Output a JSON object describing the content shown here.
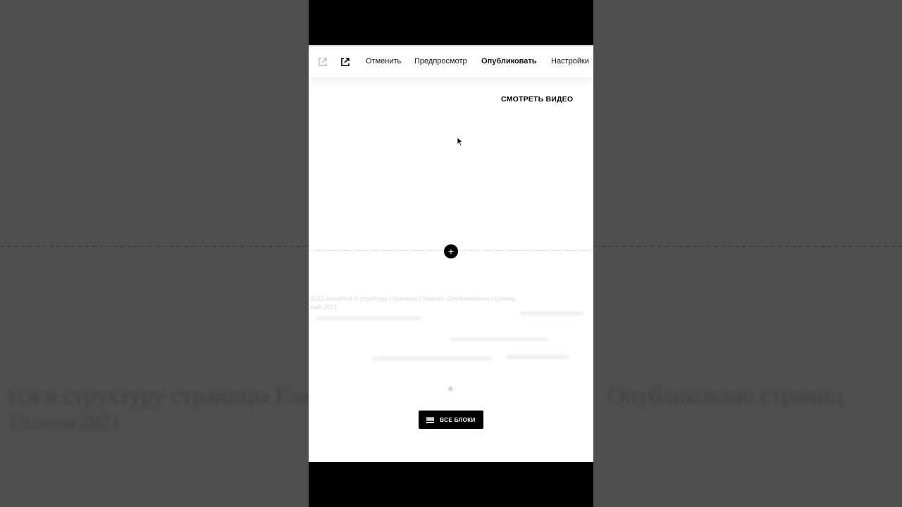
{
  "toolbar": {
    "undo_label": "Отменить",
    "preview_label": "Предпросмотр",
    "publish_label": "Опубликовать",
    "settings_label": "Настройки"
  },
  "content": {
    "watch_video_label": "СМОТРЕТЬ ВИДЕО",
    "add_block_symbol": "+",
    "all_blocks_label": "ВСЕ БЛОКИ",
    "faint_text_line1": "2021 вносятся в структуру страницы Главная. Опубликовано страниц",
    "faint_text_line2": "май 2021",
    "star_symbol": "★"
  },
  "colors": {
    "backdrop": "#4f4f4f",
    "letterbox": "#000000",
    "canvas": "#ffffff",
    "accent_button": "#000000"
  }
}
